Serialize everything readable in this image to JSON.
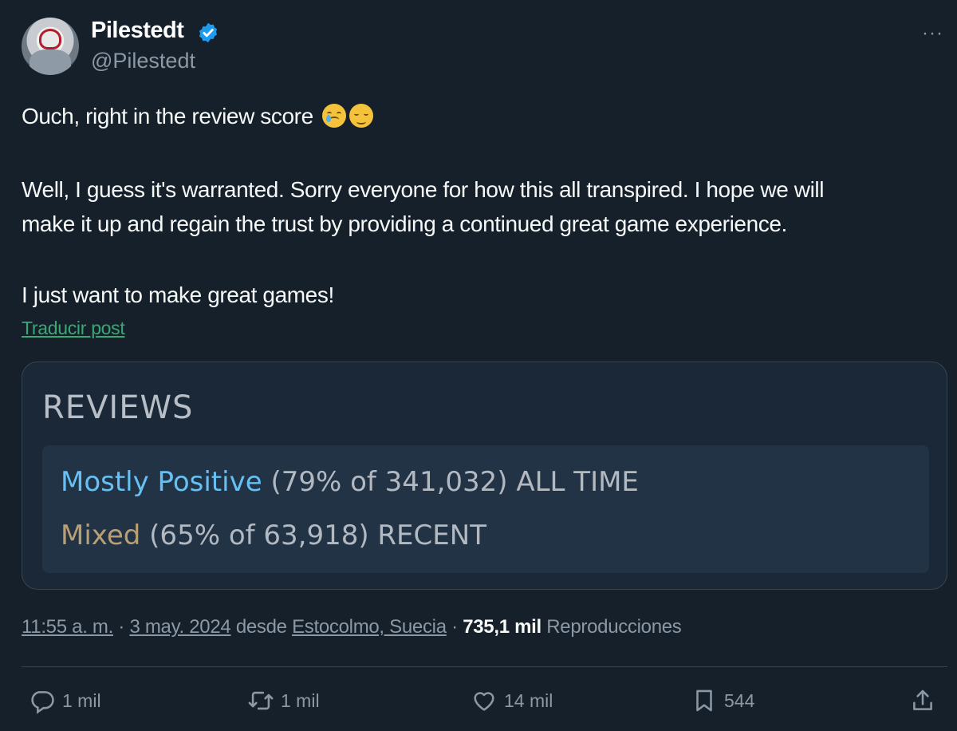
{
  "author": {
    "name": "Pilestedt",
    "handle": "@Pilestedt"
  },
  "more_label": "···",
  "post": {
    "line1": "Ouch, right in the review score",
    "line2a": "Well, I guess it's warranted. Sorry everyone for how this all transpired. I hope we will",
    "line2b": "make it up and regain the trust by providing a continued great game experience.",
    "line3": "I just want to make great games!",
    "translate": "Traducir post"
  },
  "reviews_card": {
    "title": "REVIEWS",
    "all_time": {
      "rating": "Mostly Positive",
      "detail": "(79% of 341,032) ALL TIME",
      "rating_color": "#66c0f4"
    },
    "recent": {
      "rating": "Mixed",
      "detail": "(65% of 63,918) RECENT",
      "rating_color": "#b9a074"
    }
  },
  "meta": {
    "time": "11:55 a. m.",
    "sep1": " · ",
    "date": "3 may. 2024",
    "from": " desde ",
    "location": "Estocolmo, Suecia",
    "sep2": " · ",
    "views_count": "735,1 mil",
    "views_label": " Reproducciones"
  },
  "actions": {
    "replies": "1 mil",
    "reposts": "1 mil",
    "likes": "14 mil",
    "bookmarks": "544"
  },
  "colors": {
    "background": "#15202b",
    "verified": "#1d9bf0",
    "link_green": "#3ba773"
  }
}
